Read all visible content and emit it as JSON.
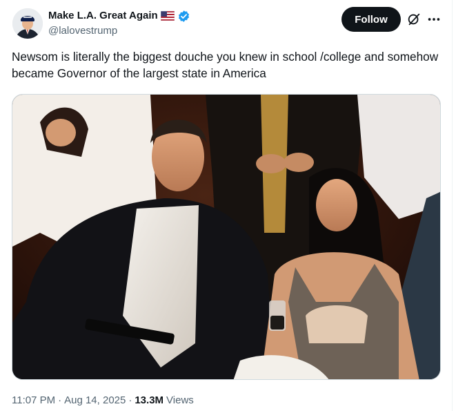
{
  "tweet": {
    "author": {
      "display_name": "Make L.A. Great Again",
      "flag_emoji": "🇺🇸",
      "handle": "@lalovestrump",
      "verified": true,
      "verified_color": "#1d9bf0",
      "avatar": "avatar-red-cap-man"
    },
    "follow_label": "Follow",
    "grok_icon": "grok-icon",
    "more_icon": "more-icon",
    "text": "Newsom is literally the biggest douche you knew in school /college and somehow became Governor of the largest state in America",
    "media": {
      "description_icon": "photo-party"
    },
    "meta": {
      "time": "11:07 PM",
      "separator": "·",
      "date": "Aug 14, 2025",
      "views_count": "13.3M",
      "views_label": "Views"
    }
  },
  "colors": {
    "text_primary": "#0f1419",
    "text_secondary": "#536471",
    "follow_bg": "#0f1419",
    "verified": "#1d9bf0",
    "border": "#cfd9de"
  }
}
